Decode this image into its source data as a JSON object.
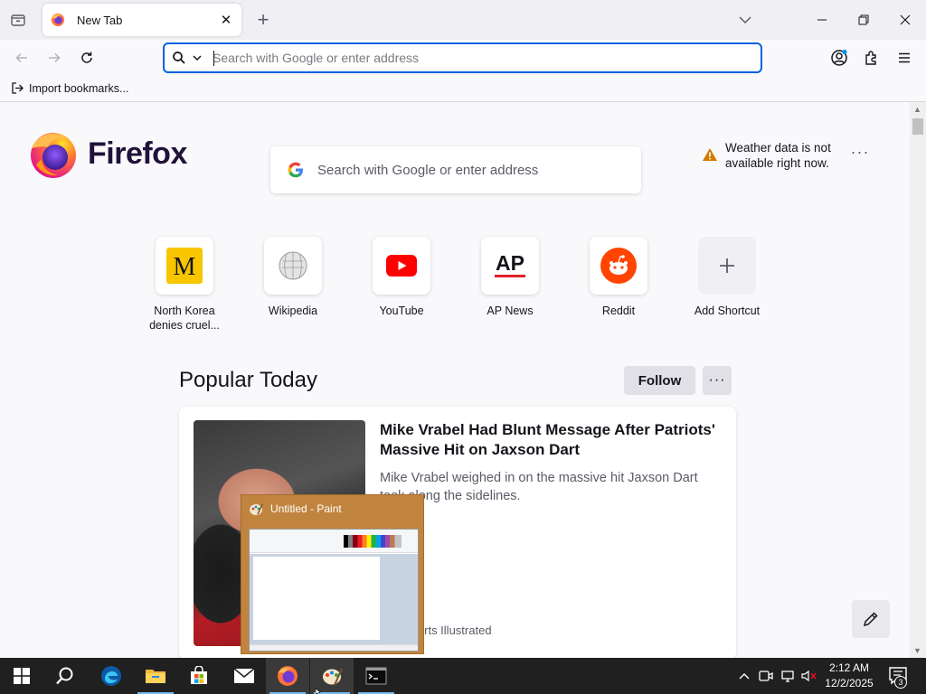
{
  "browser": {
    "tab": {
      "title": "New Tab",
      "favicon": "firefox-icon"
    },
    "new_tab_symbol": "+",
    "close_symbol": "✕",
    "urlbar": {
      "placeholder": "Search with Google or enter address",
      "value": ""
    },
    "bookmarks_toolbar": {
      "import_label": "Import bookmarks..."
    }
  },
  "newtab": {
    "brand": "Firefox",
    "search_placeholder": "Search with Google or enter address",
    "weather_message": "Weather data is not available right now.",
    "menu_dots": "···",
    "shortcuts": [
      {
        "label": "North Korea denies cruel...",
        "icon": "mcclatchy-m-icon"
      },
      {
        "label": "Wikipedia",
        "icon": "wikipedia-icon"
      },
      {
        "label": "YouTube",
        "icon": "youtube-icon"
      },
      {
        "label": "AP News",
        "icon": "ap-news-icon"
      },
      {
        "label": "Reddit",
        "icon": "reddit-icon"
      },
      {
        "label": "Add Shortcut",
        "icon": "plus-icon"
      }
    ],
    "section_title": "Popular Today",
    "follow_label": "Follow",
    "more_label": "···",
    "article": {
      "headline": "Mike Vrabel Had Blunt Message After Patriots' Massive Hit on Jaxson Dart",
      "description": "Mike Vrabel weighed in on the massive hit Jaxson Dart took along the sidelines.",
      "source": "Sports Illustrated"
    }
  },
  "paint_preview": {
    "title": "Untitled - Paint"
  },
  "taskbar": {
    "apps": [
      "start-icon",
      "search-icon",
      "edge-icon",
      "file-explorer-icon",
      "store-icon",
      "mail-icon",
      "firefox-icon",
      "paint-icon",
      "terminal-icon"
    ],
    "clock": {
      "time": "2:12 AM",
      "date": "12/2/2025"
    },
    "notification_count": "3"
  },
  "colors": {
    "accent": "#0061e0",
    "taskbar": "#202020",
    "preview_bg": "#c1843e"
  }
}
